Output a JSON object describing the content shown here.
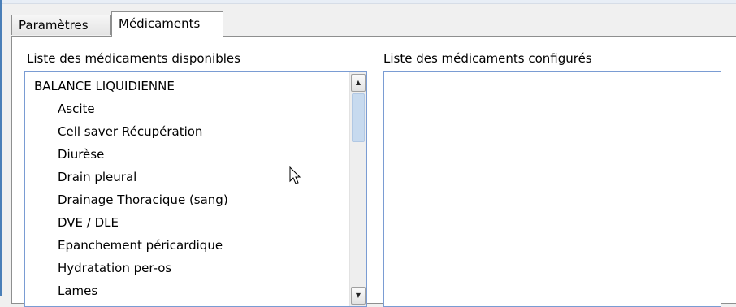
{
  "tabs": [
    {
      "label": "Paramètres"
    },
    {
      "label": "Médicaments",
      "active": true
    }
  ],
  "available": {
    "label": "Liste des médicaments disponibles",
    "items": [
      {
        "text": "BALANCE LIQUIDIENNE",
        "kind": "group"
      },
      {
        "text": "Ascite",
        "kind": "child"
      },
      {
        "text": "Cell saver Récupération",
        "kind": "child"
      },
      {
        "text": "Diurèse",
        "kind": "child"
      },
      {
        "text": "Drain pleural",
        "kind": "child"
      },
      {
        "text": "Drainage Thoracique (sang)",
        "kind": "child"
      },
      {
        "text": "DVE / DLE",
        "kind": "child"
      },
      {
        "text": "Epanchement péricardique",
        "kind": "child"
      },
      {
        "text": "Hydratation per-os",
        "kind": "child"
      },
      {
        "text": "Lames",
        "kind": "child"
      }
    ]
  },
  "configured": {
    "label": "Liste des médicaments configurés",
    "items": []
  },
  "icons": {
    "scroll_up": "up-arrow-icon",
    "scroll_down": "down-arrow-icon",
    "cursor": "mouse-pointer-icon"
  }
}
